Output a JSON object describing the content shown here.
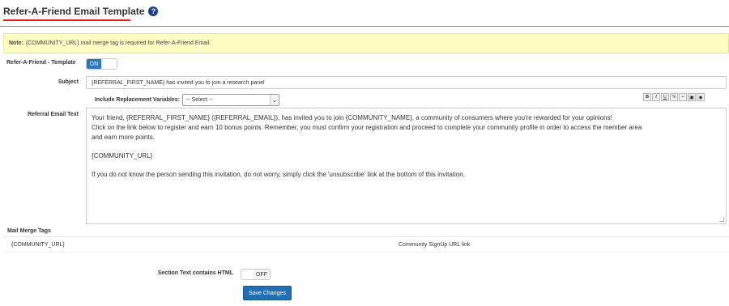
{
  "header": {
    "title": "Refer-A-Friend Email Template",
    "help_icon_glyph": "?"
  },
  "note": {
    "label": "Note:",
    "text": "{COMMUNITY_URL} mail merge tag is required for Refer-A-Friend Email."
  },
  "template_toggle": {
    "label": "Refer-A-Friend - Template",
    "state": "ON"
  },
  "subject": {
    "label": "Subject",
    "value": "{REFERRAL_FIRST_NAME} has invited you to join a research panel"
  },
  "replacement_variables": {
    "label": "Include Replacement Variables:",
    "selected": "-- Select --"
  },
  "toolbar": {
    "bold": "B",
    "italic": "I",
    "underline": "U",
    "link": "%",
    "align": "≡",
    "image": "▣",
    "preview": "◉"
  },
  "referral_email": {
    "label": "Referral Email Text",
    "line1": "Your friend, {REFERRAL_FIRST_NAME} ({REFERRAL_EMAIL}), has invited you to join {COMMUNITY_NAME}, a community of consumers where you're rewarded for your opinions!",
    "line2": "Click on the link below to register and earn 10 bonus points. Remember, you must confirm your registration and proceed to complete your community profile in order to access the member area",
    "line3": "and earn more points.",
    "line4": "{COMMUNITY_URL}",
    "line5": "If you do not know the person sending this invitation, do not worry, simply click the 'unsubscribe' link at the bottom of this invitation."
  },
  "mail_merge": {
    "header": "Mail Merge Tags",
    "tags": [
      {
        "tag": "{COMMUNITY_URL}",
        "description": "Community SignUp URL link"
      }
    ]
  },
  "html_toggle": {
    "label": "Section Text contains HTML",
    "state": "OFF"
  },
  "save": {
    "label": "Save Changes"
  },
  "colors": {
    "title_underline": "#e01a1a",
    "help_icon": "#1c3f8c",
    "note_background": "#fefec3",
    "toggle_on": "#2a78c0",
    "save_button": "#1f6fb2"
  }
}
